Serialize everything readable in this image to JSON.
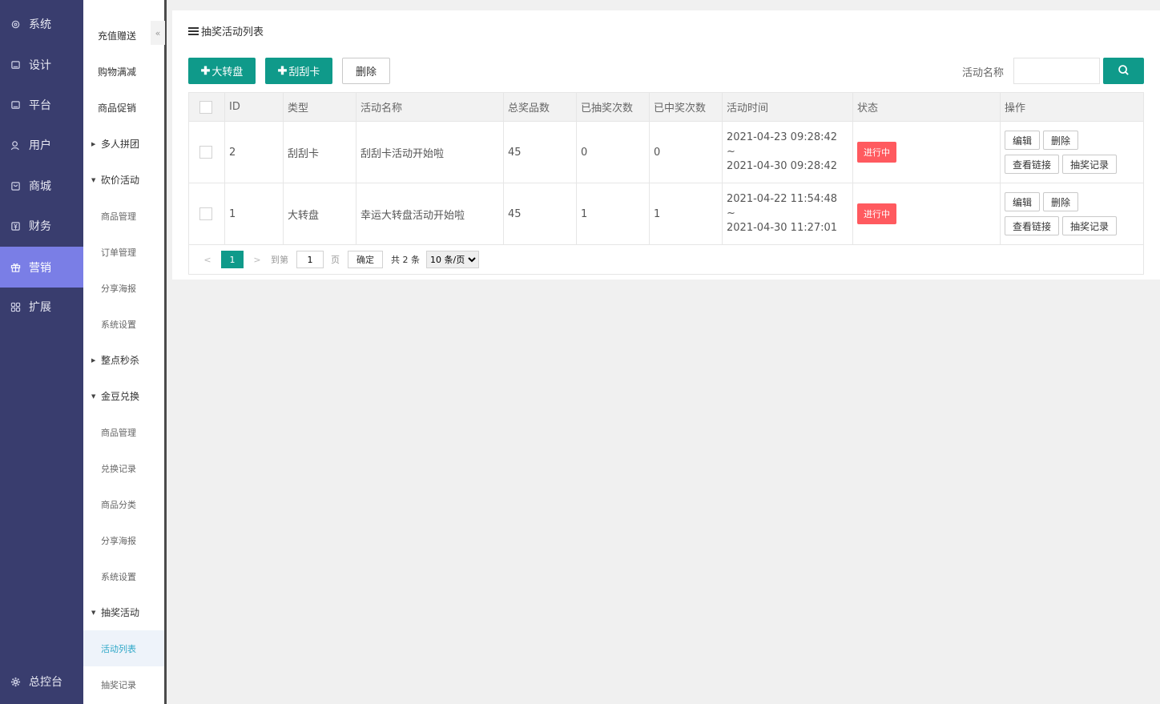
{
  "nav": {
    "items": [
      {
        "label": "系统",
        "icon": "gear-icon"
      },
      {
        "label": "设计",
        "icon": "monitor-icon"
      },
      {
        "label": "平台",
        "icon": "monitor-icon"
      },
      {
        "label": "用户",
        "icon": "user-icon"
      },
      {
        "label": "商城",
        "icon": "shop-icon"
      },
      {
        "label": "财务",
        "icon": "finance-icon"
      },
      {
        "label": "营销",
        "icon": "gift-icon"
      },
      {
        "label": "扩展",
        "icon": "grid-icon"
      }
    ],
    "bottom": {
      "label": "总控台",
      "icon": "settings-icon"
    }
  },
  "subnav": {
    "collapse": "«",
    "items": [
      {
        "label": "充值赠送"
      },
      {
        "label": "购物满减"
      },
      {
        "label": "商品促销"
      },
      {
        "label": "多人拼团"
      },
      {
        "label": "砍价活动"
      },
      {
        "label": "商品管理"
      },
      {
        "label": "订单管理"
      },
      {
        "label": "分享海报"
      },
      {
        "label": "系统设置"
      },
      {
        "label": "整点秒杀"
      },
      {
        "label": "金豆兑换"
      },
      {
        "label": "商品管理"
      },
      {
        "label": "兑换记录"
      },
      {
        "label": "商品分类"
      },
      {
        "label": "分享海报"
      },
      {
        "label": "系统设置"
      },
      {
        "label": "抽奖活动"
      },
      {
        "label": "活动列表"
      },
      {
        "label": "抽奖记录"
      }
    ]
  },
  "card": {
    "title": "抽奖活动列表",
    "buttons": {
      "add_wheel": "大转盘",
      "add_scratch": "刮刮卡",
      "delete": "删除"
    },
    "search": {
      "label": "活动名称",
      "placeholder": ""
    }
  },
  "table": {
    "headers": [
      "",
      "ID",
      "类型",
      "活动名称",
      "总奖品数",
      "已抽奖次数",
      "已中奖次数",
      "活动时间",
      "状态",
      "操作"
    ],
    "rows": [
      {
        "id": "2",
        "type": "刮刮卡",
        "name": "刮刮卡活动开始啦",
        "total": "45",
        "drawn": "0",
        "won": "0",
        "time_start": "2021-04-23 09:28:42 ~",
        "time_end": "2021-04-30 09:28:42",
        "status": "进行中"
      },
      {
        "id": "1",
        "type": "大转盘",
        "name": "幸运大转盘活动开始啦",
        "total": "45",
        "drawn": "1",
        "won": "1",
        "time_start": "2021-04-22 11:54:48 ~",
        "time_end": "2021-04-30 11:27:01",
        "status": "进行中"
      }
    ],
    "ops": {
      "edit": "编辑",
      "delete": "删除",
      "view_link": "查看链接",
      "records": "抽奖记录"
    }
  },
  "pager": {
    "current": "1",
    "goto_label": "到第",
    "page_value": "1",
    "page_unit": "页",
    "confirm": "确定",
    "total": "共 2 条",
    "per_page": "10 条/页"
  },
  "colors": {
    "nav_bg": "#393d6e",
    "nav_active": "#7a7ee6",
    "primary": "#0f9a8a",
    "status_red": "#ff5a5f"
  }
}
